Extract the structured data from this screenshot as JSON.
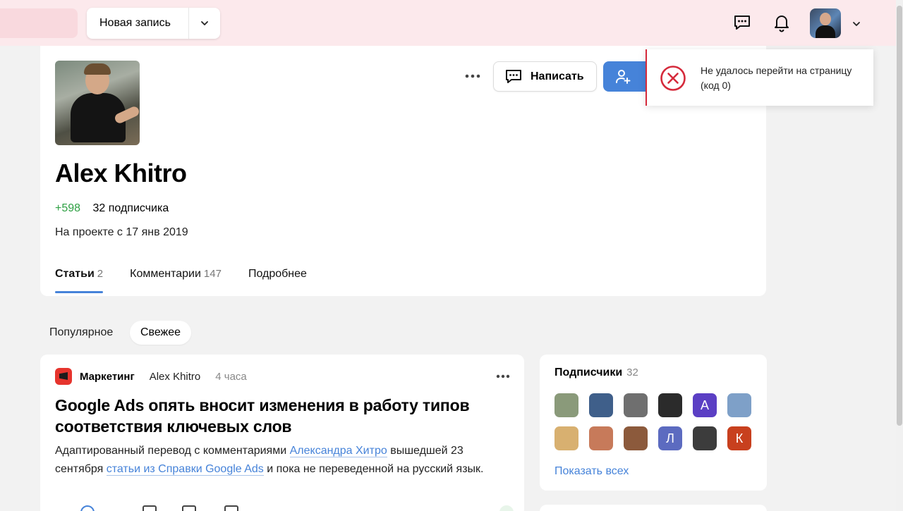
{
  "header": {
    "new_post_label": "Новая запись",
    "icons": [
      "chat-icon",
      "bell-icon",
      "chevron-down-icon"
    ]
  },
  "profile": {
    "name": "Alex Khitro",
    "karma": "+598",
    "followers": "32 подписчика",
    "joined": "На проекте с 17 янв 2019",
    "write_label": "Написать",
    "tabs": [
      {
        "label": "Статьи",
        "count": "2"
      },
      {
        "label": "Комментарии",
        "count": "147"
      },
      {
        "label": "Подробнее",
        "count": ""
      }
    ]
  },
  "toast": {
    "message": "Не удалось перейти на страницу (код 0)"
  },
  "sort": {
    "popular": "Популярное",
    "fresh": "Свежее"
  },
  "article": {
    "category": "Маркетинг",
    "author": "Alex Khitro",
    "time": "4 часа",
    "title": "Google Ads опять вносит изменения в работу типов соответствия ключевых слов",
    "body_1": "Адаптированный перевод с комментариями ",
    "link_1": "Александра Хитро",
    "body_2": " вышедшей 23 сентября ",
    "link_2": "статьи из Справки Google Ads",
    "body_3": " и пока не переведенной на русский язык."
  },
  "subscribers": {
    "title": "Подписчики",
    "count": "32",
    "show_all": "Показать всех",
    "avatars": [
      {
        "letter": "",
        "color": "#8a9a7a"
      },
      {
        "letter": "",
        "color": "#3f5f8a"
      },
      {
        "letter": "",
        "color": "#6f6f6f"
      },
      {
        "letter": "",
        "color": "#2b2b2b"
      },
      {
        "letter": "А",
        "color": "#5b3fc4"
      },
      {
        "letter": "",
        "color": "#7ea0c8"
      },
      {
        "letter": "",
        "color": "#d8b070"
      },
      {
        "letter": "",
        "color": "#c77a5a"
      },
      {
        "letter": "",
        "color": "#8c5a3c"
      },
      {
        "letter": "Л",
        "color": "#5c6bc0"
      },
      {
        "letter": "",
        "color": "#3c3c3c"
      },
      {
        "letter": "К",
        "color": "#c8401e"
      }
    ]
  },
  "colors": {
    "accent": "#4683d9",
    "karma": "#2ea043",
    "error": "#d52a3b",
    "header_bg": "#fce9ec"
  }
}
